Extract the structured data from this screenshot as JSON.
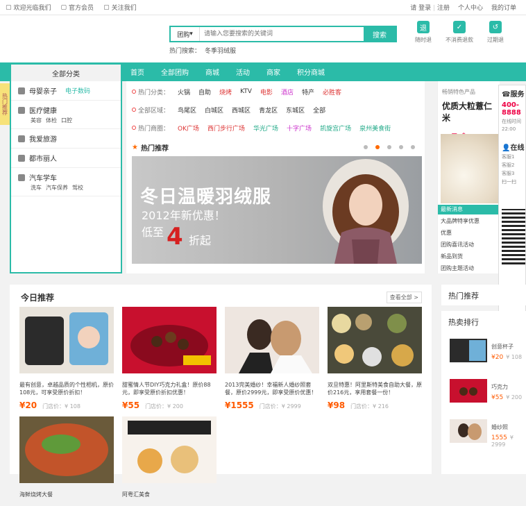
{
  "topbar": {
    "links": [
      "欢迎光临我们",
      "官方会员",
      "关注我们"
    ],
    "login": "请",
    "login_label": "登录",
    "register_label": "注册",
    "my_center": "个人中心",
    "my_order": "我的订单"
  },
  "search": {
    "category": "团购",
    "placeholder": "请输入您要搜索的关键词",
    "button": "搜索",
    "hot_label": "热门搜索：",
    "hot_words": "冬季羽绒服"
  },
  "promises": [
    "随时退",
    "不消费退款",
    "过期退"
  ],
  "nav": {
    "all_categories": "全部分类",
    "links": [
      "首页",
      "全部团购",
      "商城",
      "活动",
      "商家",
      "积分商城"
    ]
  },
  "sidetab": "热门推荐",
  "categories": [
    {
      "title": "母婴亲子",
      "highlight": "电子数码",
      "sub": []
    },
    {
      "title": "医疗健康",
      "highlight": "",
      "sub": [
        "美容",
        "体检",
        "口腔"
      ]
    },
    {
      "title": "我爱旅游",
      "highlight": "",
      "sub": []
    },
    {
      "title": "都市丽人",
      "highlight": "",
      "sub": []
    },
    {
      "title": "汽车学车",
      "highlight": "",
      "sub": [
        "洗车",
        "汽车保养",
        "驾校"
      ]
    }
  ],
  "filters": [
    {
      "label": "热门分类：",
      "items": [
        "火锅",
        "自助",
        "烧烤",
        "KTV",
        "电影",
        "酒店",
        "特产",
        "必胜客"
      ]
    },
    {
      "label": "全部区域：",
      "items": [
        "鸟尾区",
        "白城区",
        "西城区",
        "青龙区",
        "东城区",
        "全部"
      ]
    },
    {
      "label": "热门商圈：",
      "items": [
        "OK广场",
        "西门步行广场",
        "华光广场",
        "十字广场",
        "凯旋宫广场",
        "泉州美食街"
      ]
    }
  ],
  "hot_recommend": "热门推荐",
  "banner": {
    "title": "冬日温暖羽绒服",
    "subtitle": "2012年新优惠！",
    "low": "低至",
    "discount": "4",
    "unit": "折起"
  },
  "rightcol": {
    "head": "畅销特色产品",
    "item": "优质大粒薏仁米",
    "price": "28元/盒",
    "news_title": "最新消息",
    "news": [
      "大品牌特享优惠",
      "优惠",
      "团购喜讯活动",
      "新品到货",
      "团购主题活动"
    ]
  },
  "service": {
    "title": "服务",
    "phone": "400-8888",
    "hours_label": "在线时间",
    "hours": "22:00",
    "online_title": "在线",
    "agents": [
      "客服1",
      "客服2",
      "客服3"
    ],
    "qr_label": "扫一扫"
  },
  "today": {
    "title": "今日推荐",
    "more": "查看全部 >",
    "products": [
      {
        "name": "最有创意，卓越品质的个性相机，原价108元，可享受原价折扣！",
        "price": "¥20",
        "orig": "门店价：¥ 108"
      },
      {
        "name": "甜蜜情人节DIY巧克力礼盒！原价88元，即享受原价折扣优惠！",
        "price": "¥55",
        "orig": "门店价：¥ 200"
      },
      {
        "name": "2013完美婚纱！幸福新人婚纱照套餐，原价2999元，即享受原价优惠！",
        "price": "¥1555",
        "orig": "门店价：¥ 2999"
      },
      {
        "name": "双旦特惠！阿里斯特美食自助大餐，原价216元，享用套餐一份！",
        "price": "¥98",
        "orig": "门店价：¥ 216"
      },
      {
        "name": "海鲜烧烤大餐",
        "price": "",
        "orig": ""
      },
      {
        "name": "阿粤汇美食",
        "price": "",
        "orig": ""
      }
    ]
  },
  "hotlist_title": "热门推荐",
  "salerank": {
    "title": "热卖排行",
    "items": [
      {
        "name": "创意杯子",
        "price": "¥20",
        "orig": "¥ 108"
      },
      {
        "name": "巧克力",
        "price": "¥55",
        "orig": "¥ 200"
      },
      {
        "name": "婚纱照",
        "price": "1555",
        "orig": "¥ 2999"
      }
    ]
  }
}
